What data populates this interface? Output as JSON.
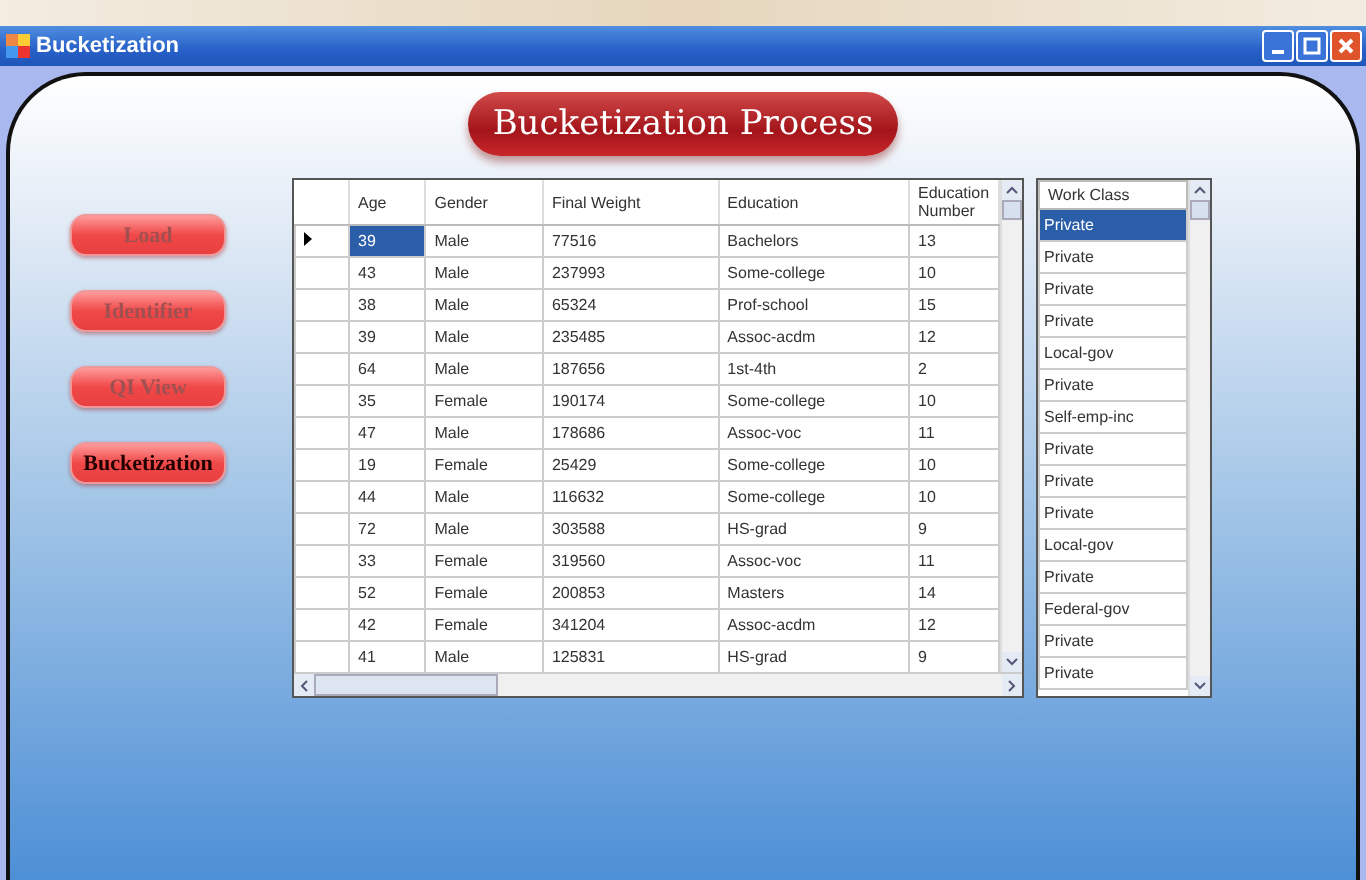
{
  "window": {
    "title": "Bucketization"
  },
  "heading": "Bucketization Process",
  "nav_buttons": [
    {
      "label": "Load",
      "selected": false
    },
    {
      "label": "Identifier",
      "selected": false
    },
    {
      "label": "QI View",
      "selected": false
    },
    {
      "label": "Bucketization",
      "selected": true
    }
  ],
  "table": {
    "columns": [
      "Age",
      "Gender",
      "Final Weight",
      "Education",
      "Education Number"
    ],
    "rows": [
      {
        "current": true,
        "cells": [
          "39",
          "Male",
          "77516",
          "Bachelors",
          "13"
        ]
      },
      {
        "current": false,
        "cells": [
          "43",
          "Male",
          "237993",
          "Some-college",
          "10"
        ]
      },
      {
        "current": false,
        "cells": [
          "38",
          "Male",
          "65324",
          "Prof-school",
          "15"
        ]
      },
      {
        "current": false,
        "cells": [
          "39",
          "Male",
          "235485",
          "Assoc-acdm",
          "12"
        ]
      },
      {
        "current": false,
        "cells": [
          "64",
          "Male",
          "187656",
          "1st-4th",
          "2"
        ]
      },
      {
        "current": false,
        "cells": [
          "35",
          "Female",
          "190174",
          "Some-college",
          "10"
        ]
      },
      {
        "current": false,
        "cells": [
          "47",
          "Male",
          "178686",
          "Assoc-voc",
          "11"
        ]
      },
      {
        "current": false,
        "cells": [
          "19",
          "Female",
          "25429",
          "Some-college",
          "10"
        ]
      },
      {
        "current": false,
        "cells": [
          "44",
          "Male",
          "116632",
          "Some-college",
          "10"
        ]
      },
      {
        "current": false,
        "cells": [
          "72",
          "Male",
          "303588",
          "HS-grad",
          "9"
        ]
      },
      {
        "current": false,
        "cells": [
          "33",
          "Female",
          "319560",
          "Assoc-voc",
          "11"
        ]
      },
      {
        "current": false,
        "cells": [
          "52",
          "Female",
          "200853",
          "Masters",
          "14"
        ]
      },
      {
        "current": false,
        "cells": [
          "42",
          "Female",
          "341204",
          "Assoc-acdm",
          "12"
        ]
      },
      {
        "current": false,
        "cells": [
          "41",
          "Male",
          "125831",
          "HS-grad",
          "9"
        ]
      }
    ]
  },
  "work_class": {
    "column": "Work Class",
    "rows": [
      {
        "value": "Private",
        "selected": true
      },
      {
        "value": "Private",
        "selected": false
      },
      {
        "value": "Private",
        "selected": false
      },
      {
        "value": "Private",
        "selected": false
      },
      {
        "value": "Local-gov",
        "selected": false
      },
      {
        "value": "Private",
        "selected": false
      },
      {
        "value": "Self-emp-inc",
        "selected": false
      },
      {
        "value": "Private",
        "selected": false
      },
      {
        "value": "Private",
        "selected": false
      },
      {
        "value": "Private",
        "selected": false
      },
      {
        "value": "Local-gov",
        "selected": false
      },
      {
        "value": "Private",
        "selected": false
      },
      {
        "value": "Federal-gov",
        "selected": false
      },
      {
        "value": "Private",
        "selected": false
      },
      {
        "value": "Private",
        "selected": false
      }
    ]
  }
}
